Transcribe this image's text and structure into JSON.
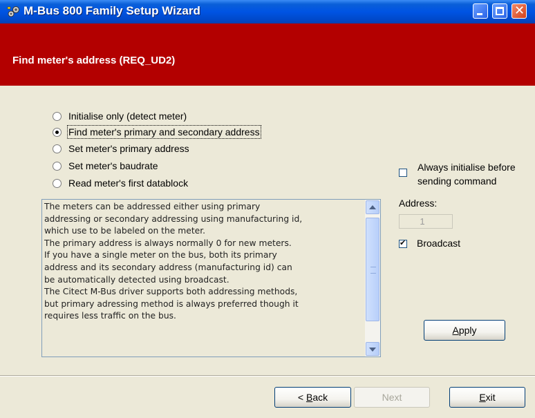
{
  "window": {
    "title": "M-Bus 800 Family Setup Wizard",
    "icon": "wizard-app-icon"
  },
  "banner": {
    "title": "Find meter's address (REQ_UD2)",
    "color": "#b30000"
  },
  "options": [
    {
      "label": "Initialise only (detect meter)",
      "checked": false
    },
    {
      "label": "Find meter's primary and secondary address",
      "checked": true
    },
    {
      "label": "Set meter's primary address",
      "checked": false
    },
    {
      "label": "Set meter's baudrate",
      "checked": false
    },
    {
      "label": "Read meter's first datablock",
      "checked": false
    }
  ],
  "description": {
    "lines": [
      "The meters can be addressed either using primary",
      "addressing or secondary addressing using manufacturing id,",
      "which use to be labeled on the meter.",
      "The primary address is always normally 0 for new meters.",
      "If you have a single meter on the bus, both its primary",
      "address and its secondary address (manufacturing id) can",
      "be automatically detected using broadcast.",
      "The Citect M-Bus driver supports both addressing methods,",
      "but primary adressing method is always preferred though it",
      "requires less traffic on the bus."
    ]
  },
  "settings": {
    "always_initialise_line1": "Always initialise before",
    "always_initialise_line2": "sending command",
    "always_initialise_checked": false,
    "address_label": "Address:",
    "address_value": "1",
    "broadcast_label": "Broadcast",
    "broadcast_checked": true,
    "apply_label_first": "A",
    "apply_label_rest": "pply"
  },
  "footer": {
    "back_prefix": "< ",
    "back_first": "B",
    "back_rest": "ack",
    "next_label": "Next",
    "next_enabled": false,
    "exit_first": "E",
    "exit_rest": "xit"
  }
}
